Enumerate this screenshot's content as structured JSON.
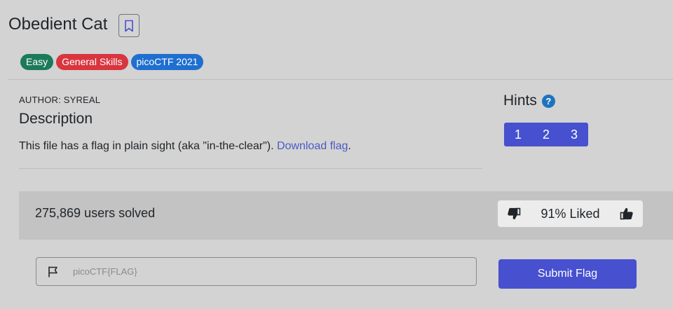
{
  "challenge": {
    "title": "Obedient Cat",
    "tags": [
      {
        "label": "Easy",
        "color": "#1b7a5a"
      },
      {
        "label": "General Skills",
        "color": "#d9353f"
      },
      {
        "label": "picoCTF 2021",
        "color": "#1f6fd0"
      }
    ],
    "author": "AUTHOR: SYREAL",
    "description_heading": "Description",
    "description_text": "This file has a flag in plain sight (aka \"in-the-clear\"). ",
    "download_link": "Download flag",
    "description_end": "."
  },
  "hints": {
    "heading": "Hints",
    "help_icon": "?",
    "buttons": [
      "1",
      "2",
      "3"
    ]
  },
  "stats": {
    "solved": "275,869 users solved",
    "liked": "91% Liked"
  },
  "flag_form": {
    "placeholder": "picoCTF{FLAG}",
    "submit_label": "Submit Flag"
  },
  "colors": {
    "accent": "#4750cf",
    "background": "#d3d3d3"
  }
}
